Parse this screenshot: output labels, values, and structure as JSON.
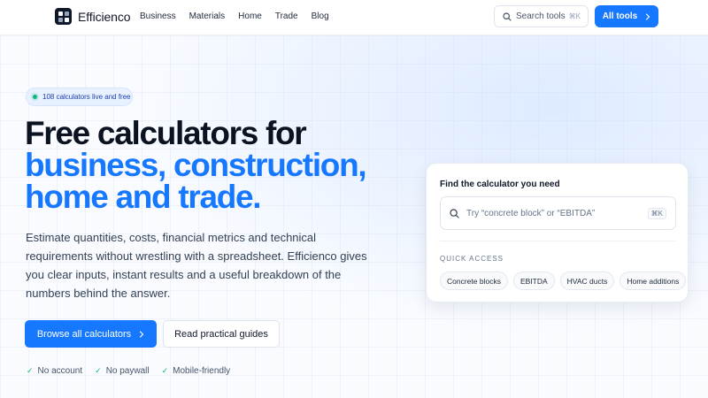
{
  "header": {
    "brand": "Efficienco",
    "nav": [
      "Business",
      "Materials",
      "Home",
      "Trade",
      "Blog"
    ],
    "search_label": "Search tools",
    "search_shortcut": "⌘K",
    "cta_label": "All tools"
  },
  "hero": {
    "badge": "108 calculators live and free",
    "title_line1": "Free calculators for",
    "title_line2": "business, construction,",
    "title_line3": "home and trade.",
    "description": "Estimate quantities, costs, financial metrics and technical requirements without wrestling with a spreadsheet. Efficienco gives you clear inputs, instant results and a useful breakdown of the numbers behind the answer.",
    "primary_button": "Browse all calculators",
    "secondary_button": "Read practical guides",
    "checks": [
      "No account",
      "No paywall",
      "Mobile-friendly"
    ]
  },
  "finder": {
    "title": "Find the calculator you need",
    "placeholder": "Try “concrete block” or “EBITDA”",
    "shortcut": "⌘K",
    "quick_access_label": "QUICK ACCESS",
    "chips": [
      "Concrete blocks",
      "EBITDA",
      "HVAC ducts",
      "Home additions"
    ]
  },
  "colors": {
    "accent": "#1677ff",
    "live_dot": "#10b981",
    "text_dark": "#0b1220"
  }
}
